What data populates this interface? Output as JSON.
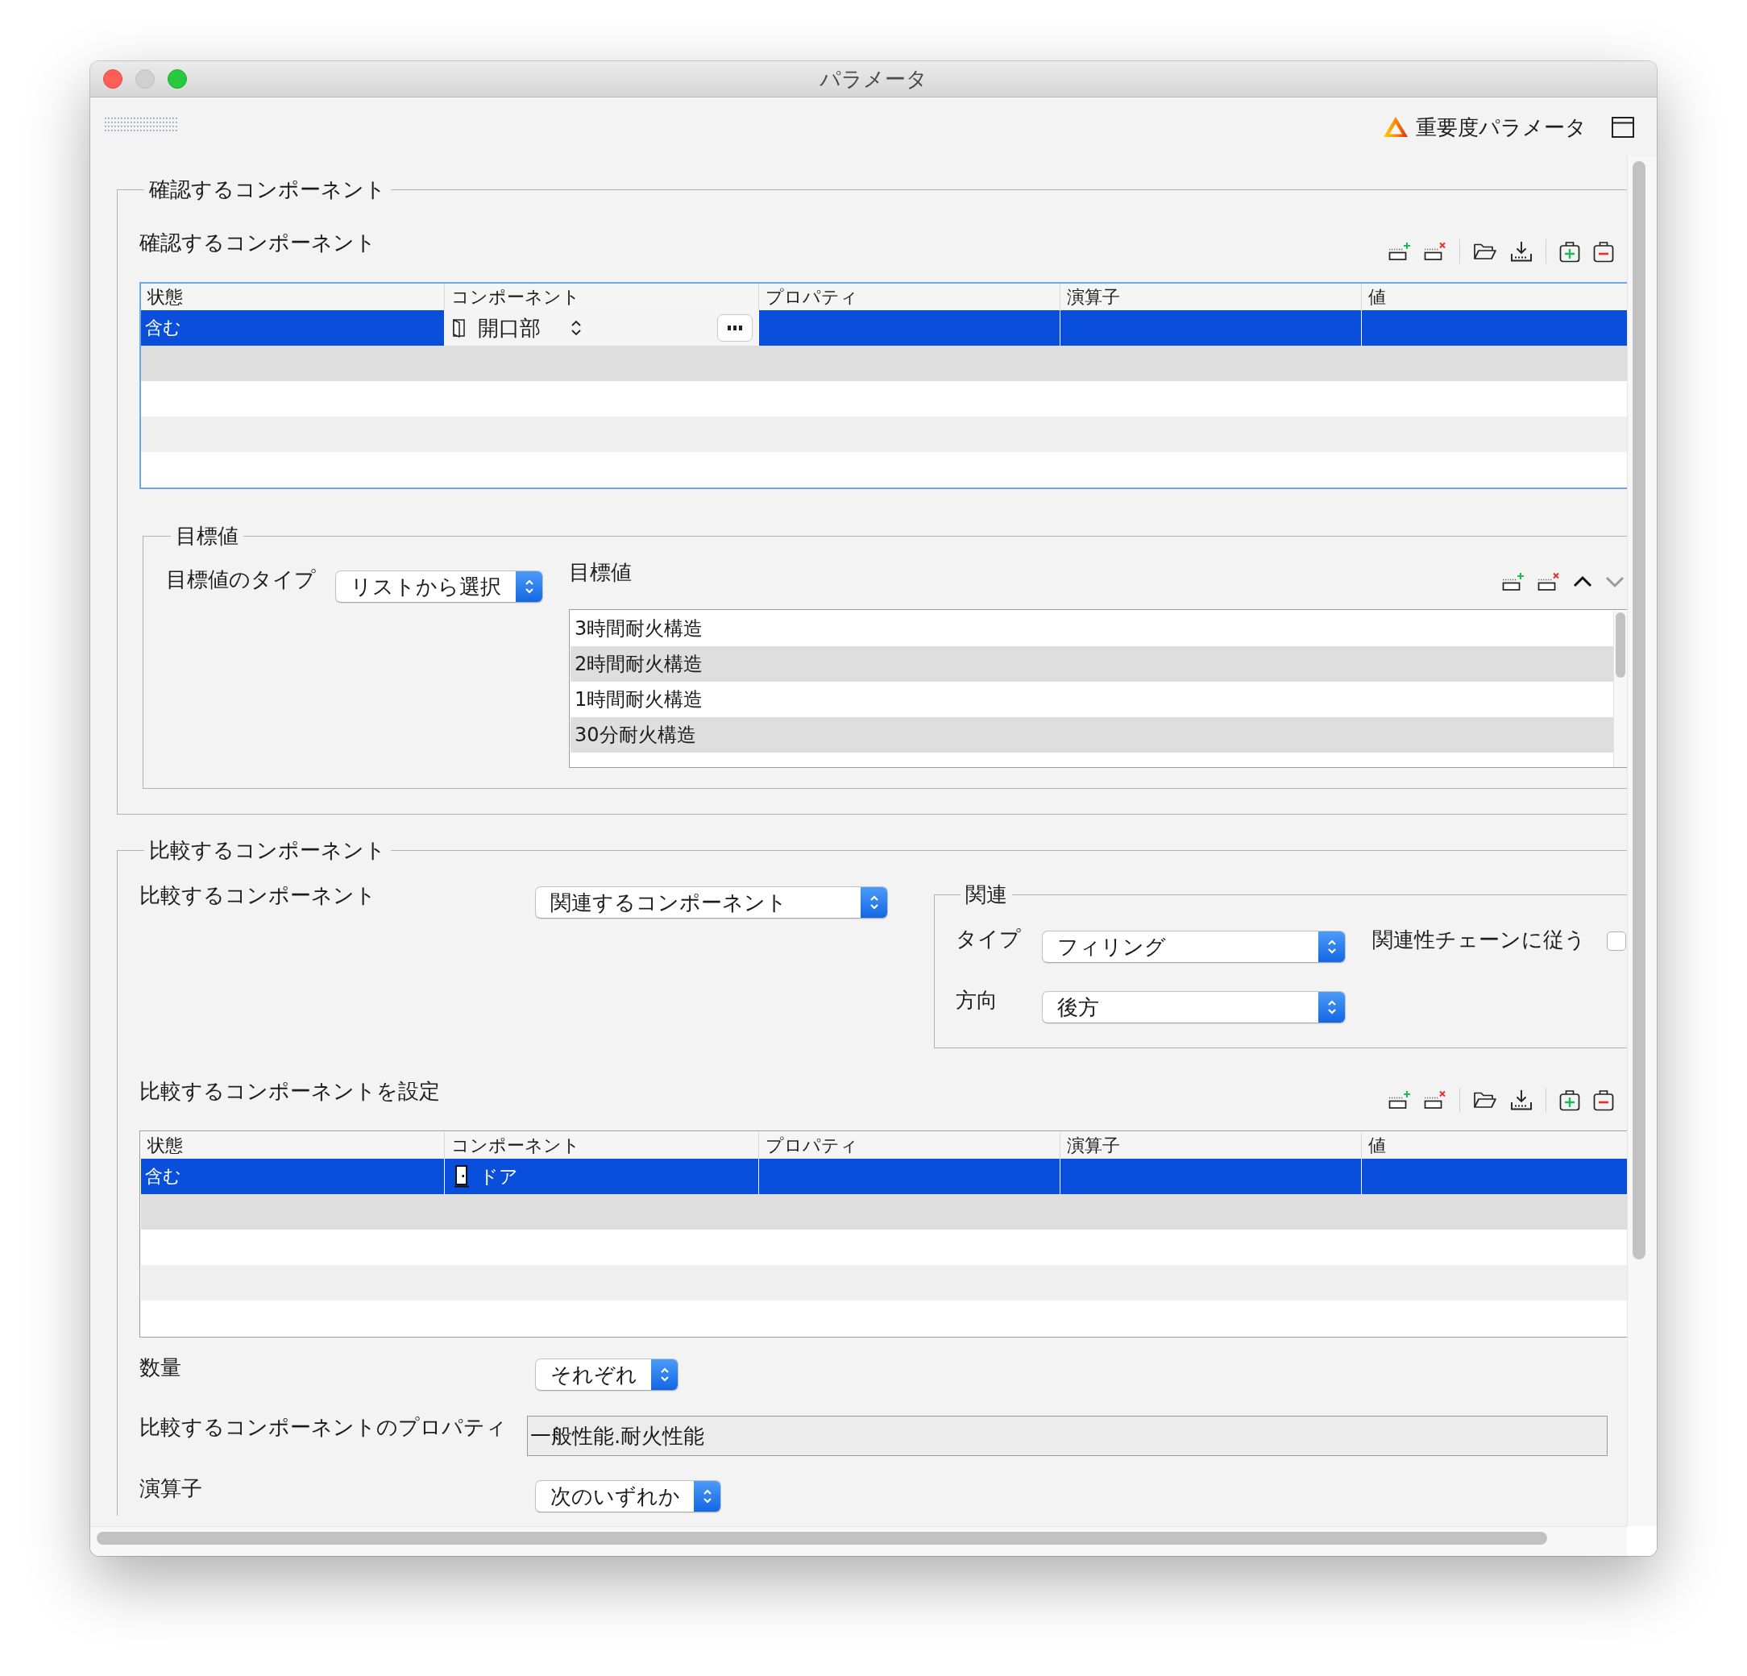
{
  "window": {
    "title": "パラメータ",
    "controls": [
      {
        "disabled": false
      },
      {
        "disabled": true
      },
      {
        "disabled": false
      }
    ]
  },
  "toolbar": {
    "severity_label": "重要度パラメータ"
  },
  "check_section": {
    "legend": "確認するコンポーネント",
    "title": "確認するコンポーネント",
    "table": {
      "focused": true,
      "columns": [
        "状態",
        "コンポーネント",
        "プロパティ",
        "演算子",
        "値"
      ],
      "rows": [
        {
          "selected": true,
          "editing": true,
          "status": "含む",
          "component": "開口部"
        }
      ]
    },
    "target": {
      "legend": "目標値",
      "type_label": "目標値のタイプ",
      "type_value": "リストから選択",
      "list_label": "目標値",
      "move_buttons": [
        {
          "disabled": false
        },
        {
          "disabled": true
        }
      ],
      "items": [
        "3時間耐火構造",
        "2時間耐火構造",
        "1時間耐火構造",
        "30分耐火構造"
      ]
    }
  },
  "compare_section": {
    "legend": "比較するコンポーネント",
    "source_label": "比較するコンポーネント",
    "source_value": "関連するコンポーネント",
    "relation": {
      "legend": "関連",
      "type_label": "タイプ",
      "type_value": "フィリング",
      "chain_label": "関連性チェーンに従う",
      "chain_checked": false,
      "direction_label": "方向",
      "direction_value": "後方"
    },
    "title": "比較するコンポーネントを設定",
    "table": {
      "focused": false,
      "columns": [
        "状態",
        "コンポーネント",
        "プロパティ",
        "演算子",
        "値"
      ],
      "rows": [
        {
          "selected": true,
          "editing": false,
          "status": "含む",
          "component": "ドア"
        }
      ]
    },
    "quantity_label": "数量",
    "quantity_value": "それぞれ",
    "property_label": "比較するコンポーネントのプロパティ",
    "property": {
      "value": "一般性能.耐火性能",
      "disabled": true
    },
    "operator_label": "演算子",
    "operator_value": "次のいずれか"
  }
}
